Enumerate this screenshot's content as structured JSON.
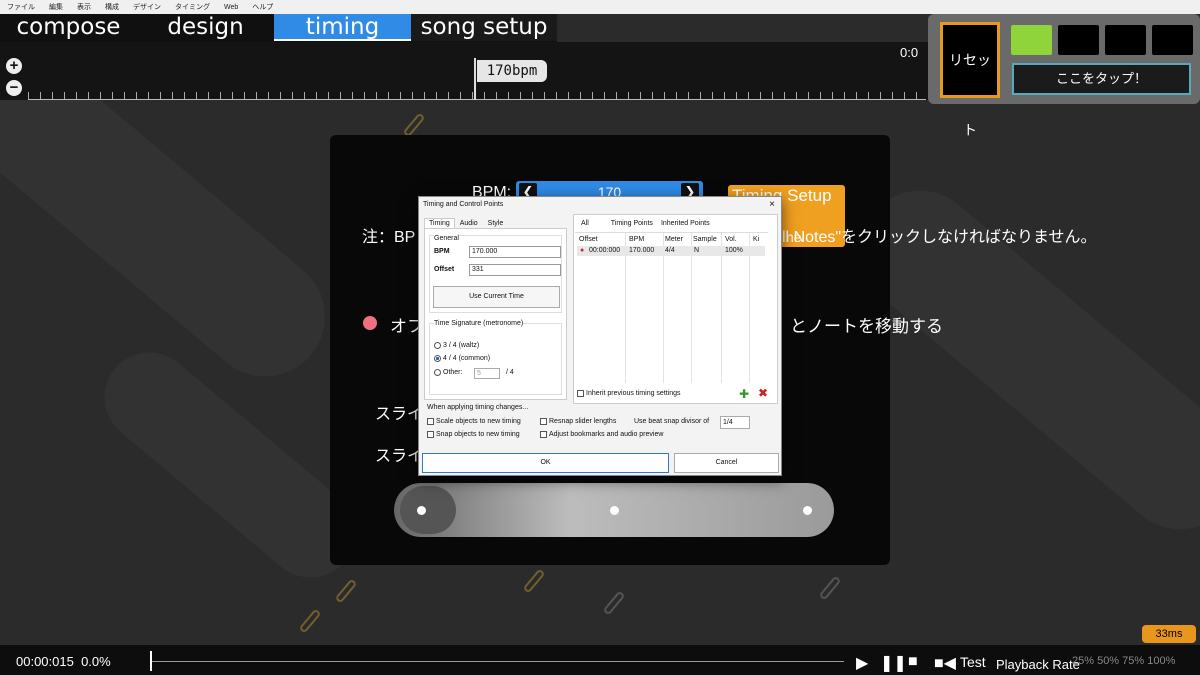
{
  "menu": [
    "ファイル",
    "編集",
    "表示",
    "構成",
    "デザイン",
    "タイミング",
    "Web",
    "ヘルプ"
  ],
  "tabs": [
    "compose",
    "design",
    "timing",
    "song setup"
  ],
  "timeline": {
    "bpm_flag": "170bpm",
    "time_right": "0:0"
  },
  "right_panel": {
    "reset": "リセット",
    "tap": "ここをタップ！",
    "colors": [
      "#8fd43a",
      "#000000",
      "#000000",
      "#000000"
    ]
  },
  "panel": {
    "bpm_label": "BPM:",
    "bpm_value": "170",
    "timing_setup": "Timing Setup",
    "timing_setup_line2": "nel",
    "note_left": "注：BP",
    "note_right": "ll Notes\"をクリックしなければなりません。",
    "line_o": "オフ",
    "line_o_right": "とノートを移動する",
    "sura1": "スライ",
    "sura2": "スライ"
  },
  "dialog": {
    "title": "Timing and Control Points",
    "close": "×",
    "tabs": [
      "Timing",
      "Audio",
      "Style"
    ],
    "general": "General",
    "bpm_label": "BPM",
    "bpm_value": "170.000",
    "offset_label": "Offset",
    "offset_value": "331",
    "use_current": "Use Current Time",
    "time_sig": "Time Signature (metronome)",
    "sig_options": [
      "3 / 4 (waltz)",
      "4 / 4 (common)",
      "Other:"
    ],
    "other_value": "5",
    "other_denom": "/ 4",
    "right_tabs": [
      "All",
      "Timing Points",
      "Inherited Points"
    ],
    "columns": [
      "Offset",
      "BPM",
      "Meter",
      "Sample",
      "Vol.",
      "Ki"
    ],
    "row": [
      "00:00:000",
      "170.000",
      "4/4",
      "N",
      "100%"
    ],
    "inherit": "Inherit previous timing settings",
    "applying": "When applying timing changes...",
    "opt_scale": "Scale objects to new timing",
    "opt_snap": "Snap objects to new timing",
    "opt_resnap": "Resnap slider lengths",
    "opt_adjust": "Adjust bookmarks and audio preview",
    "beat_snap": "Use beat snap divisor of",
    "beat_snap_value": "1/4",
    "ok": "OK",
    "cancel": "Cancel"
  },
  "bottom": {
    "time": "00:00:015",
    "percent": "0.0%",
    "ms": "33ms",
    "test": "Test",
    "rate": "Playback Rate",
    "rate_opts": "25%  50%  75%  100%"
  }
}
